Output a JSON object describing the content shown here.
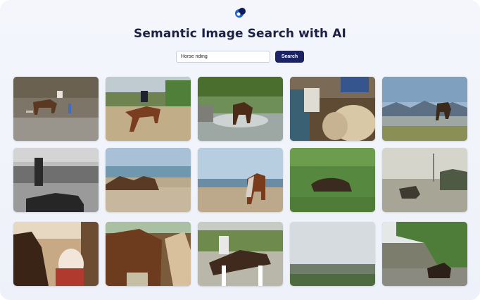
{
  "app": {
    "title": "Semantic Image Search with AI",
    "logo_icon": "logo-icon",
    "accent_color": "#1c2364"
  },
  "search": {
    "value": "Horse riding",
    "button_label": "Search"
  },
  "results": {
    "icon": "photo",
    "items": [
      {
        "subject": "horse in indoor arena"
      },
      {
        "subject": "rider on chestnut horse"
      },
      {
        "subject": "horse splashing through water"
      },
      {
        "subject": "people petting horses"
      },
      {
        "subject": "rider on horse in mountains"
      },
      {
        "subject": "black and white horse and handler"
      },
      {
        "subject": "group riding on beach"
      },
      {
        "subject": "riders on beach shoreline"
      },
      {
        "subject": "horse rolling in grass"
      },
      {
        "subject": "horses in misty field"
      },
      {
        "subject": "mother and child with horse"
      },
      {
        "subject": "horse close-up heads"
      },
      {
        "subject": "show jumping rider"
      },
      {
        "subject": "cloudy landscape view"
      },
      {
        "subject": "horses on country road"
      }
    ]
  }
}
